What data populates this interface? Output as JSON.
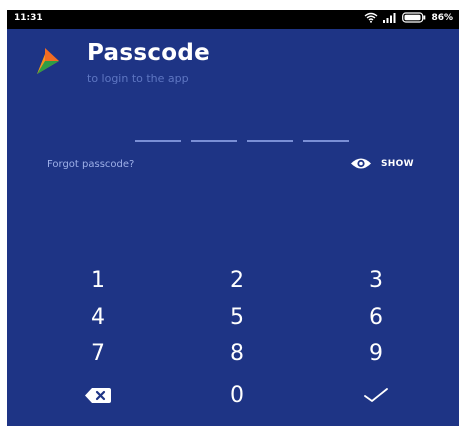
{
  "status_bar": {
    "time": "11:31",
    "battery": "86%"
  },
  "header": {
    "title": "Passcode",
    "subtitle": "to login to the app"
  },
  "passcode": {
    "digits": 4
  },
  "links": {
    "forgot": "Forgot passcode?",
    "show": "SHOW"
  },
  "keypad": {
    "keys": [
      "1",
      "2",
      "3",
      "4",
      "5",
      "6",
      "7",
      "8",
      "9",
      "0"
    ],
    "backspace_icon": "backspace-icon",
    "confirm_icon": "checkmark-icon"
  },
  "colors": {
    "background": "#1e3485",
    "logo_orange": "#f26c22",
    "logo_green": "#2e9e45"
  }
}
